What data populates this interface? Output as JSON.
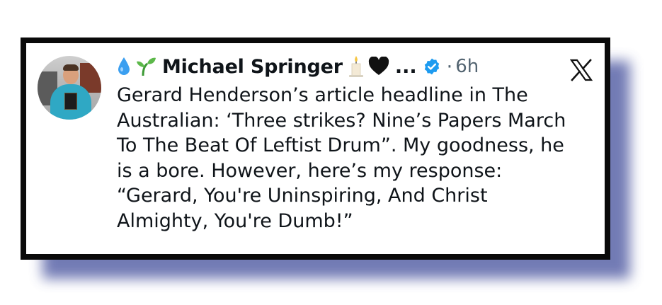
{
  "post": {
    "author": {
      "display_name": "Michael Springer",
      "name_emoji_before": [
        "droplet-icon",
        "seedling-icon"
      ],
      "name_emoji_after": [
        "candle-icon",
        "black-heart-icon"
      ],
      "truncation": "...",
      "verified": true
    },
    "separator": "·",
    "timestamp": "6h",
    "platform_icon": "x-logo-icon",
    "text": "Gerard Henderson’s article headline in The\nAustralian: ‘Three strikes? Nine’s Papers March\nTo The Beat Of Leftist Drum”. My goodness, he\nis a bore. However, here’s my response:\n“Gerard, You're Uninspiring, And Christ\nAlmighty, You're Dumb!”"
  },
  "colors": {
    "frame_border": "#0a0a0a",
    "shadow": "#5a64a8",
    "verified_badge": "#1d9bf0",
    "text_primary": "#0f1419",
    "text_secondary": "#536471"
  }
}
